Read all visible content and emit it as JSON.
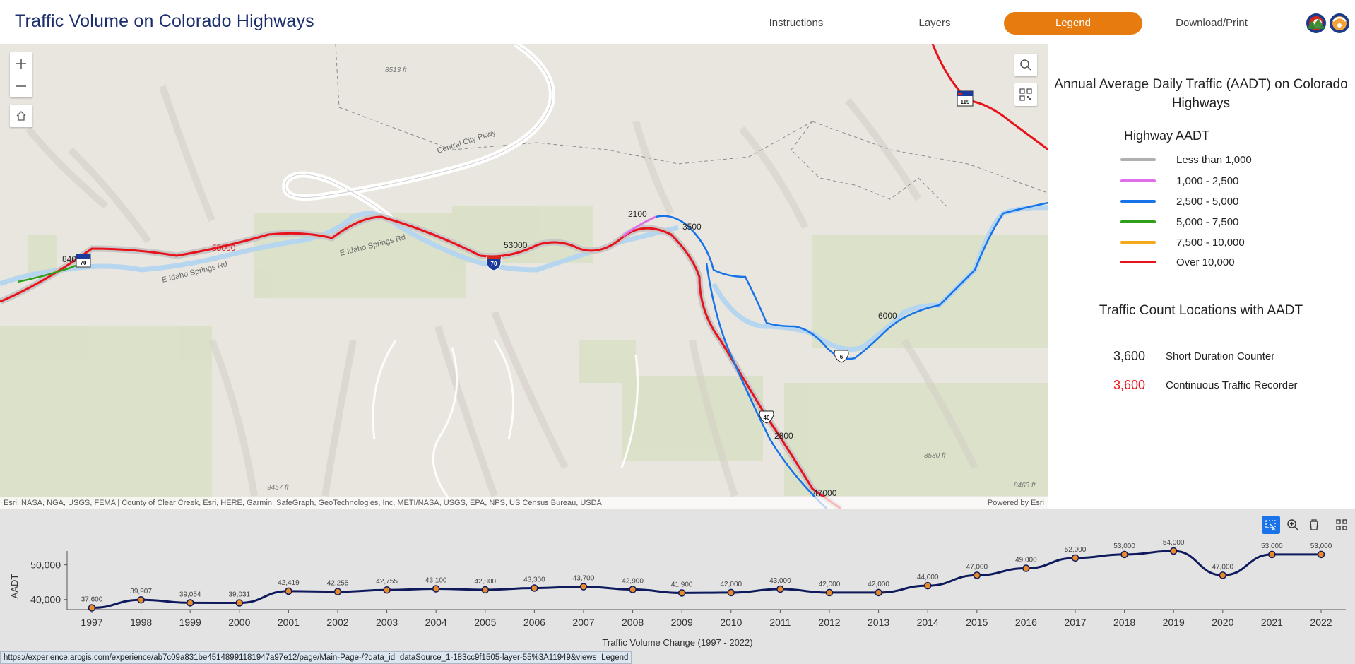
{
  "header": {
    "title": "Traffic Volume on Colorado Highways",
    "nav": [
      {
        "label": "Instructions",
        "active": false
      },
      {
        "label": "Layers",
        "active": false
      },
      {
        "label": "Legend",
        "active": true
      },
      {
        "label": "Download/Print",
        "active": false
      }
    ],
    "accent_color": "#e87b0f",
    "title_color": "#1b2e6e"
  },
  "map": {
    "labels": {
      "road_central_city": "Central City Pkwy",
      "road_idaho_springs_1": "E Idaho Springs Rd",
      "road_idaho_springs_2": "E Idaho Springs Rd",
      "elev_1": "8513 ft",
      "elev_2": "9457 ft",
      "elev_3": "8580 ft",
      "elev_4": "8463 ft"
    },
    "counts": {
      "c8400": "8400",
      "c55000": "55000",
      "c53000": "53000",
      "c2100": "2100",
      "c3500": "3500",
      "c6000": "6000",
      "c2800": "2800",
      "c47000": "47000"
    },
    "shields": {
      "i70_a": "70",
      "i70_b": "70",
      "us6": "6",
      "us40": "40",
      "sh119": "119"
    },
    "attribution": "Esri, NASA, NGA, USGS, FEMA | County of Clear Creek, Esri, HERE, Garmin, SafeGraph, GeoTechnologies, Inc, METI/NASA, USGS, EPA, NPS, US Census Bureau, USDA",
    "powered_by": "Powered by Esri",
    "controls": [
      "zoom-in-icon",
      "zoom-out-icon",
      "home-icon",
      "search-icon",
      "qr-code-icon"
    ]
  },
  "legend": {
    "title": "Annual Average Daily Traffic (AADT) on Colorado Highways",
    "aadt_heading": "Highway AADT",
    "classes": [
      {
        "label": "Less than 1,000",
        "color": "#b0b0b0"
      },
      {
        "label": "1,000 - 2,500",
        "color": "#e06ee8"
      },
      {
        "label": "2,500 - 5,000",
        "color": "#1873e8"
      },
      {
        "label": "5,000 - 7,500",
        "color": "#2f9e1a"
      },
      {
        "label": "7,500 - 10,000",
        "color": "#f4a81c"
      },
      {
        "label": "Over 10,000",
        "color": "#e8121a"
      }
    ],
    "count_heading": "Traffic Count Locations with AADT",
    "count_types": [
      {
        "value": "3,600",
        "label": "Short Duration Counter",
        "color": "#222222"
      },
      {
        "value": "3,600",
        "label": "Continuous Traffic Recorder",
        "color": "#e8121a"
      }
    ]
  },
  "chart_tools": [
    "selection-icon",
    "zoom-icon",
    "clear-selection-icon",
    "grid-icon"
  ],
  "chart_data": {
    "type": "line",
    "title": "",
    "xlabel": "Traffic Volume Change (1997 - 2022)",
    "ylabel": "AADT",
    "x": [
      "1997",
      "1998",
      "1999",
      "2000",
      "2001",
      "2002",
      "2003",
      "2004",
      "2005",
      "2006",
      "2007",
      "2008",
      "2009",
      "2010",
      "2011",
      "2012",
      "2013",
      "2014",
      "2015",
      "2016",
      "2017",
      "2018",
      "2019",
      "2020",
      "2021",
      "2022"
    ],
    "values": [
      37600,
      39907,
      39054,
      39031,
      42419,
      42255,
      42755,
      43100,
      42800,
      43300,
      43700,
      42900,
      41900,
      42000,
      43000,
      42000,
      42000,
      44000,
      47000,
      49000,
      52000,
      53000,
      54000,
      47000,
      53000,
      53000
    ],
    "data_labels": [
      "37,600",
      "39,907",
      "39,054",
      "39,031",
      "42,419",
      "42,255",
      "42,755",
      "43,100",
      "42,800",
      "43,300",
      "43,700",
      "42,900",
      "41,900",
      "42,000",
      "43,000",
      "42,000",
      "42,000",
      "44,000",
      "47,000",
      "49,000",
      "52,000",
      "53,000",
      "54,000",
      "47,000",
      "53,000",
      "53,000"
    ],
    "y_ticks": [
      40000,
      50000
    ],
    "y_tick_labels": [
      "40,000",
      "50,000"
    ],
    "ylim": [
      37300,
      54000
    ],
    "line_color": "#0e1a5c",
    "marker_color": "#e8892a"
  },
  "status_url": "https://experience.arcgis.com/experience/ab7c09a831be45148991181947a97e12/page/Main-Page-/?data_id=dataSource_1-183cc9f1505-layer-55%3A11949&views=Legend"
}
